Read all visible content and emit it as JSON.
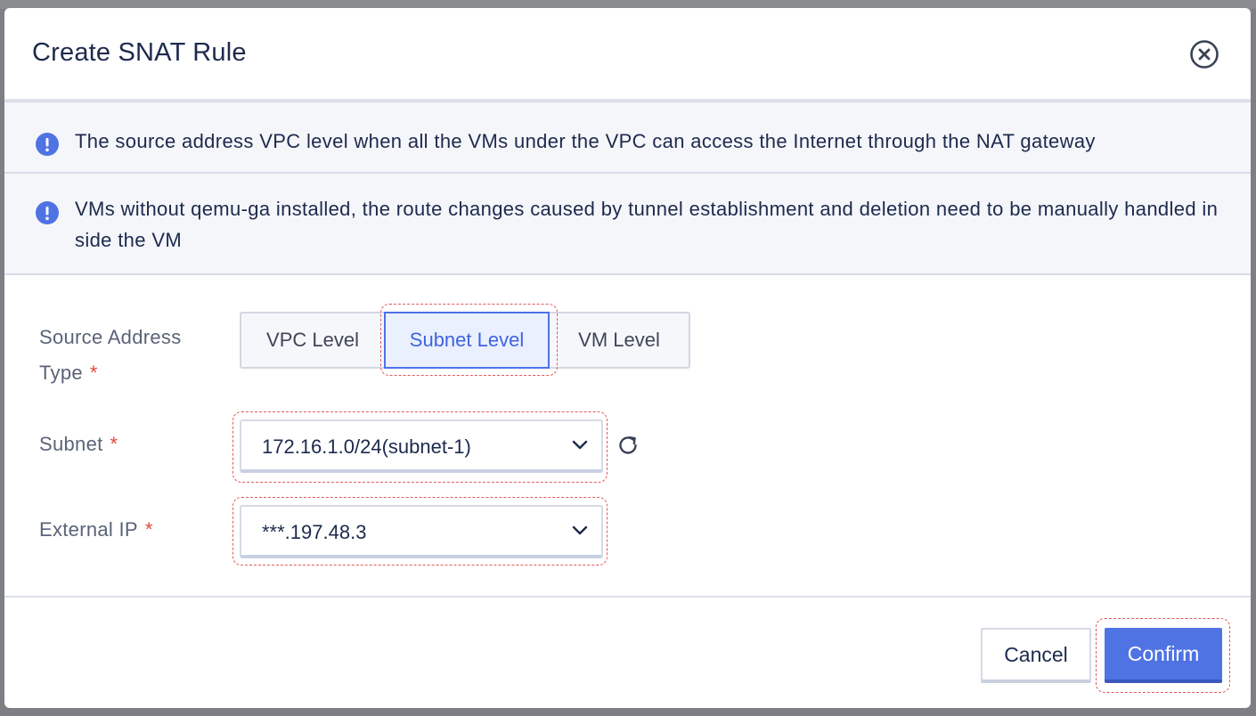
{
  "dialog": {
    "title": "Create SNAT Rule"
  },
  "notices": [
    {
      "icon": "info-icon",
      "text": "The source address VPC level when all the VMs under the VPC can access the Internet through the NAT gateway"
    },
    {
      "icon": "info-icon",
      "text": "VMs without qemu-ga installed, the route changes caused by tunnel establishment and deletion need to be manually handled inside the VM"
    }
  ],
  "form": {
    "source_address_type": {
      "label": "Source Address Type",
      "required_mark": "*",
      "options": [
        "VPC Level",
        "Subnet Level",
        "VM Level"
      ],
      "selected": "Subnet Level"
    },
    "subnet": {
      "label": "Subnet",
      "required_mark": "*",
      "value": "172.16.1.0/24(subnet-1)"
    },
    "external_ip": {
      "label": "External IP",
      "required_mark": "*",
      "value": "***.197.48.3"
    }
  },
  "footer": {
    "cancel_label": "Cancel",
    "confirm_label": "Confirm"
  },
  "colors": {
    "accent": "#4f73e3",
    "info_icon": "#4f73e3",
    "required": "#e0483a",
    "highlight_dash": "#e05a5a"
  }
}
